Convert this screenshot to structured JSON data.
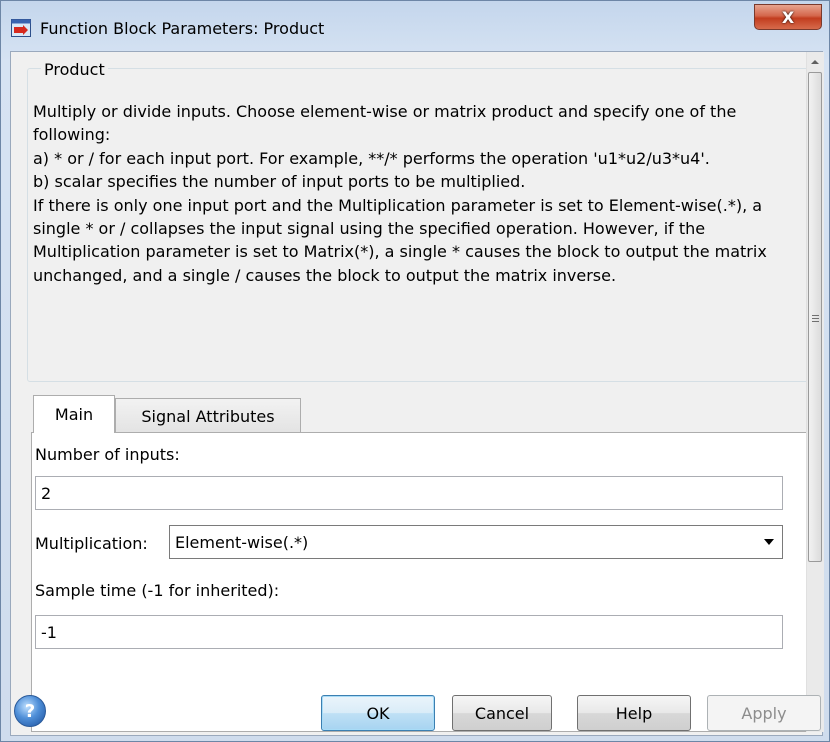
{
  "window": {
    "title": "Function Block Parameters: Product",
    "close_glyph": "X"
  },
  "group": {
    "title": "Product",
    "description": "Multiply or divide inputs.  Choose element-wise or matrix product and specify one of the following:\n a) * or / for each input port. For example, **/* performs the operation 'u1*u2/u3*u4'.\n b) scalar specifies the number of input ports to be multiplied.\nIf there is only one input port and the Multiplication parameter is set to Element-wise(.*), a single * or / collapses the input signal using the specified operation.  However, if the Multiplication parameter is set to Matrix(*), a single * causes the block to output the matrix unchanged, and a single / causes the block to output the matrix inverse."
  },
  "tabs": [
    {
      "label": "Main",
      "active": true
    },
    {
      "label": "Signal Attributes",
      "active": false
    }
  ],
  "main": {
    "number_of_inputs_label": "Number of inputs:",
    "number_of_inputs_value": "2",
    "multiplication_label": "Multiplication:",
    "multiplication_value": "Element-wise(.*)",
    "sample_time_label": "Sample time (-1 for inherited):",
    "sample_time_value": "-1"
  },
  "buttons": {
    "help_glyph": "?",
    "ok": "OK",
    "cancel": "Cancel",
    "help": "Help",
    "apply": "Apply"
  },
  "colors": {
    "ok_accent": "#3c7fb1",
    "close_button": "#c23d1f",
    "disabled_text": "#8d8d8d"
  }
}
